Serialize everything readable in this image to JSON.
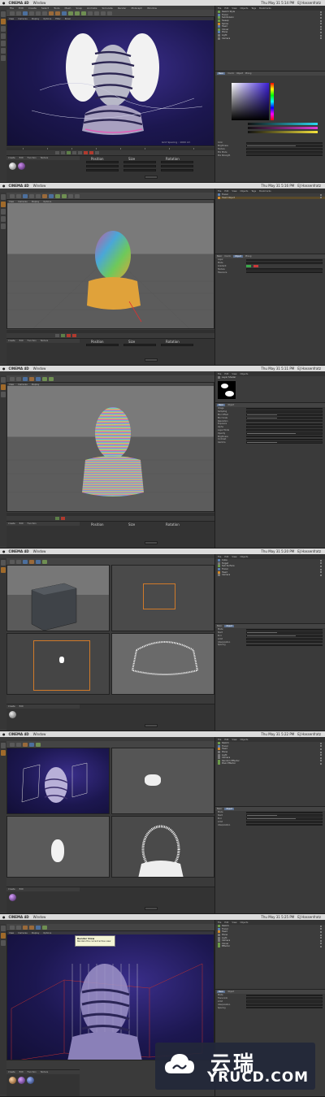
{
  "app": {
    "name": "CINEMA 4D",
    "menu_window": "Window"
  },
  "mac_menu": [
    "File",
    "Edit",
    "Create",
    "Select",
    "Tools",
    "Mesh",
    "Snap",
    "Animate",
    "Simulate",
    "Render",
    "Sculpt",
    "Motion Tracker",
    "MoGraph",
    "Character",
    "Pipeline",
    "Plugins",
    "Script",
    "Window",
    "Help"
  ],
  "frames": [
    {
      "clock": "Thu May 31 5:14 PM",
      "user": "EJ Hassenfratz",
      "file_title": "Abstract Strings Project.c4d"
    },
    {
      "clock": "Thu May 31 5:16 PM",
      "user": "EJ Hassenfratz",
      "file_title": ""
    },
    {
      "clock": "Thu May 31 5:11 PM",
      "user": "EJ Hassenfratz",
      "file_title": ""
    },
    {
      "clock": "Thu May 31 5:20 PM",
      "user": "EJ Hassenfratz",
      "file_title": ""
    },
    {
      "clock": "Thu May 31 5:22 PM",
      "user": "EJ Hassenfratz",
      "file_title": ""
    },
    {
      "clock": "Thu May 31 5:25 PM",
      "user": "EJ Hassenfratz",
      "file_title": ""
    }
  ],
  "object_panel_tabs": [
    "File",
    "Edit",
    "View",
    "Objects",
    "Tags",
    "Bookmarks"
  ],
  "material_tabs": [
    "Create",
    "Edit",
    "Function",
    "Texture",
    "Mr.Hanger"
  ],
  "coord_headers": [
    "Position",
    "Size",
    "Rotation"
  ],
  "coord_axes": [
    "X",
    "Y",
    "Z"
  ],
  "coord_values": {
    "pos": [
      "0 cm",
      "0 cm",
      "0 cm"
    ],
    "size": [
      "2.4 cm",
      "0 cm",
      "0 cm"
    ],
    "rot": [
      "0 °",
      "0 °",
      "0 °"
    ]
  },
  "apply_label": "Apply",
  "attr_tabs": [
    "Basic",
    "Coord.",
    "Object",
    "Phong"
  ],
  "objects_f1": [
    "Sketch Style",
    "Tracer",
    "Subdivision",
    "Sweep",
    "Spline",
    "Head",
    "Cloner",
    "Plane",
    "Light",
    "Camera"
  ],
  "objects_f2": [
    "Tracer",
    "Head Object"
  ],
  "objects_f3": [
    "Layer Shader"
  ],
  "objects_f4": [
    "Cube",
    "Target",
    "Sub Surface",
    "Tracer",
    "Head",
    "Camera"
  ],
  "objects_f5": [
    "Sketch",
    "Tracer",
    "Head",
    "Plane",
    "Light",
    "Camera",
    "Random Effector",
    "Plain Effector"
  ],
  "objects_f6": [
    "Sketch",
    "Tracer",
    "Head",
    "Plane",
    "Light",
    "Camera",
    "Cloner",
    "Effector"
  ],
  "attr_labels_f1": [
    "Color",
    "Brightness",
    "Texture",
    "Mix Mode",
    "Mix Strength"
  ],
  "attr_labels_f2": [
    "Layer",
    "Mode",
    "Gradient",
    "Texture",
    "Tolerance"
  ],
  "attr_labels_f3": [
    "Image",
    "Sampling",
    "Blur Offset",
    "Blur Scale",
    "Resolution",
    "Exposure",
    "Alpha",
    "Layer Mode",
    "Opacity",
    "Brightness",
    "Contrast",
    "Gamma"
  ],
  "attr_labels_f4": [
    "Mode",
    "Start",
    "End",
    "Limit",
    "Interpolation",
    "Spacing"
  ],
  "attr_labels_f5": [
    "Mode",
    "Start",
    "End",
    "Limit",
    "Interpolation"
  ],
  "attr_labels_f6": [
    "Mode",
    "Trace Link",
    "Limit",
    "Interpolation",
    "Spacing"
  ],
  "tooltip": {
    "title": "Render View",
    "body": "Renders the current active view"
  },
  "status_text": "Grid Spacing : 1000 cm",
  "watermark": {
    "cn": "云瑞",
    "en": "YRUCD.COM"
  },
  "colors": {
    "accent_orange": "#d28a2a",
    "viewport_purple": "#1c1750",
    "panel_bg": "#3c3c3c"
  }
}
